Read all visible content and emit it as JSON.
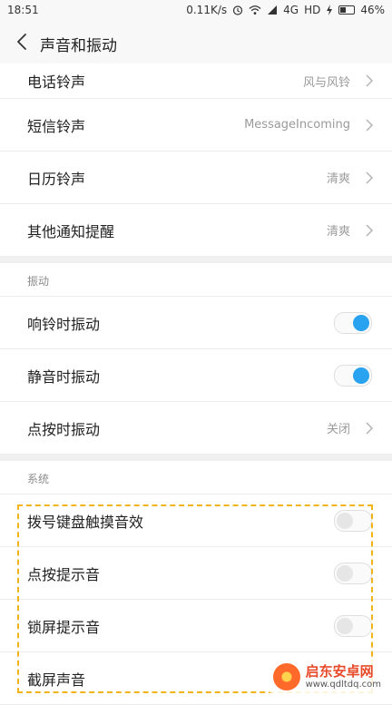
{
  "status_bar": {
    "time": "18:51",
    "speed": "0.11K/s",
    "network": "4G",
    "hd": "HD",
    "battery": "46%",
    "battery_level": 0.46
  },
  "header": {
    "title": "声音和振动"
  },
  "ringtones": {
    "items": [
      {
        "label": "电话铃声",
        "value": "风与风铃"
      },
      {
        "label": "短信铃声",
        "value": "MessageIncoming"
      },
      {
        "label": "日历铃声",
        "value": "清爽"
      },
      {
        "label": "其他通知提醒",
        "value": "清爽"
      }
    ]
  },
  "vibration": {
    "section_title": "振动",
    "ring_vibrate": {
      "label": "响铃时振动",
      "on": true
    },
    "silent_vibrate": {
      "label": "静音时振动",
      "on": true
    },
    "touch_vibrate": {
      "label": "点按时振动",
      "value": "关闭"
    }
  },
  "system": {
    "section_title": "系统",
    "items": [
      {
        "label": "拨号键盘触摸音效",
        "on": false
      },
      {
        "label": "点按提示音",
        "on": false
      },
      {
        "label": "锁屏提示音",
        "on": false
      },
      {
        "label": "截屏声音"
      }
    ]
  },
  "watermark": {
    "title": "启东安卓网",
    "url": "www.qdltdq.com"
  },
  "colors": {
    "accent": "#29a3ef",
    "highlight": "#f0b419"
  }
}
